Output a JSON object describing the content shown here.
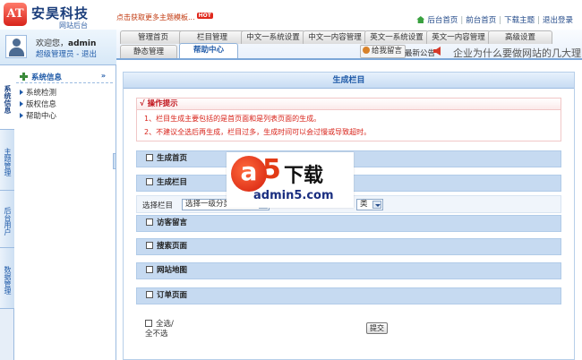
{
  "header": {
    "logo_mark": "AT",
    "logo_title": "安昊科技",
    "logo_sub": "网站后台",
    "promo_text": "点击获取更多主题模板...",
    "hot_badge": "HOT",
    "links": [
      "后台首页",
      "前台首页",
      "下载主题",
      "退出登录"
    ]
  },
  "user": {
    "welcome_prefix": "欢迎您，",
    "username": "admin",
    "role": "超级管理员",
    "logout": "- 退出"
  },
  "tabs_row1": [
    "管理首页",
    "栏目管理",
    "中文一系统设置",
    "中文一内容管理",
    "英文一系统设置",
    "英文一内容管理",
    "高级设置"
  ],
  "tabs_row2": [
    "静态管理",
    "帮助中心"
  ],
  "active_tab": "帮助中心",
  "message_button": "给我留言",
  "notice": {
    "label": "最新公告",
    "text": "企业为什么要做网站的几大理"
  },
  "sidebar": {
    "vertical_tabs": [
      "系统信息",
      "主题管理",
      "后台用户",
      "数据管理"
    ],
    "section_title": "系统信息",
    "items": [
      "系统检测",
      "版权信息",
      "帮助中心"
    ]
  },
  "main": {
    "title": "生成栏目",
    "tip_title": "√ 操作提示",
    "tips": [
      "1、栏目生成主要包括的是首页面和是列表页面的生成。",
      "2、不建议全选后再生成，栏目过多，生成时间可以会过慢或导致超时。"
    ],
    "sections": [
      "生成首页",
      "生成栏目",
      "访客留言",
      "搜索页面",
      "网站地图",
      "订单页面"
    ],
    "column_label": "选择栏目",
    "select_level1": "选择一级分类",
    "select_level2": "类",
    "select_all": "全选/全不选",
    "submit": "提交"
  },
  "watermark": {
    "a": "a",
    "five": "5",
    "cn": "下载",
    "url": "admin5.com"
  },
  "colors": {
    "accent_blue": "#1f5aa8",
    "section_bg": "#c6daf1",
    "tip_red": "#d8231a"
  }
}
